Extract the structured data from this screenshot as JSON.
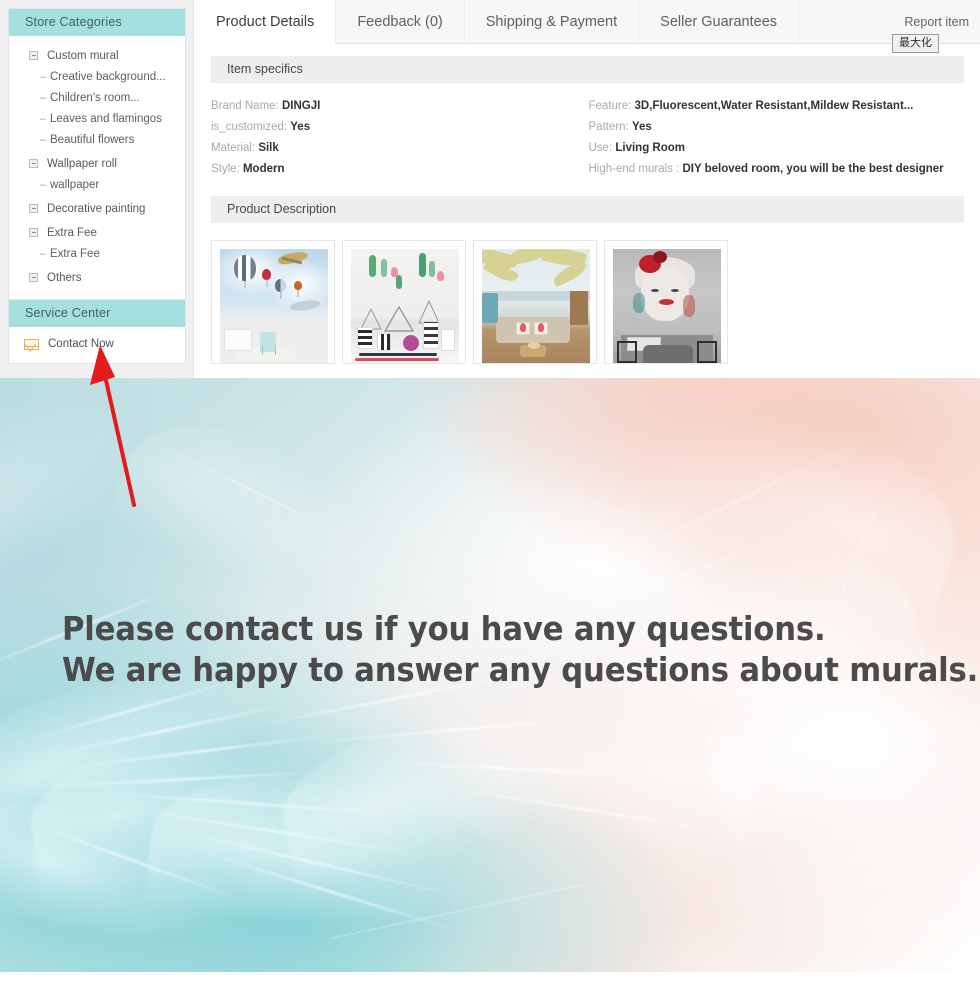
{
  "sidebar": {
    "categories_panel": {
      "title": "Store Categories",
      "items": [
        {
          "label": "Custom mural",
          "type": "parent",
          "children": [
            "Creative background...",
            "Children's room...",
            "Leaves and flamingos",
            "Beautiful flowers"
          ]
        },
        {
          "label": "Wallpaper roll",
          "type": "parent",
          "children": [
            "wallpaper"
          ]
        },
        {
          "label": "Decorative painting",
          "type": "parent",
          "children": []
        },
        {
          "label": "Extra Fee",
          "type": "parent",
          "children": [
            "Extra Fee"
          ]
        },
        {
          "label": "Others",
          "type": "parent",
          "children": []
        }
      ]
    },
    "service_panel": {
      "title": "Service Center",
      "contact_label": "Contact Now",
      "contact_icon": "envelope-icon"
    }
  },
  "tabs": [
    {
      "label": "Product Details",
      "active": true
    },
    {
      "label": "Feedback (0)",
      "active": false
    },
    {
      "label": "Shipping & Payment",
      "active": false
    },
    {
      "label": "Seller Guarantees",
      "active": false
    }
  ],
  "report_item_label": "Report item",
  "tooltip": {
    "text": "最大化"
  },
  "item_specifics": {
    "title": "Item specifics",
    "left": [
      {
        "key": "Brand Name:",
        "value": "DINGJI"
      },
      {
        "key": "is_customized:",
        "value": "Yes"
      },
      {
        "key": "Material:",
        "value": "Silk"
      },
      {
        "key": "Style:",
        "value": "Modern"
      }
    ],
    "right": [
      {
        "key": "Feature:",
        "value": "3D,Fluorescent,Water Resistant,Mildew Resistant..."
      },
      {
        "key": "Pattern:",
        "value": "Yes"
      },
      {
        "key": "Use:",
        "value": "Living Room"
      },
      {
        "key": "High-end murals :",
        "value": "DIY beloved room, you will be the best designer"
      }
    ]
  },
  "product_description": {
    "title": "Product Description",
    "thumbnails": [
      {
        "name": "kids-room-hot-air-balloons-mural"
      },
      {
        "name": "cactus-flamingo-desk-mural"
      },
      {
        "name": "palm-leaf-flamingo-sofa-mural"
      },
      {
        "name": "marilyn-monroe-portrait-mural"
      }
    ]
  },
  "banner": {
    "line1": "Please contact us if you have any questions.",
    "line2": "We are happy to answer any questions about murals.",
    "background": "feather-texture-teal-pink"
  },
  "annotation": {
    "arrow": "red-arrow-pointing-to-contact-now",
    "color": "#e51a1a"
  },
  "colors": {
    "panel_header": "#a6e0de",
    "section_bar": "#eeeeee",
    "tab_inactive_bg": "#f7f7f7",
    "banner_text": "#4b4b4b",
    "annotation_red": "#e51a1a",
    "envelope_orange": "#e8b451"
  }
}
